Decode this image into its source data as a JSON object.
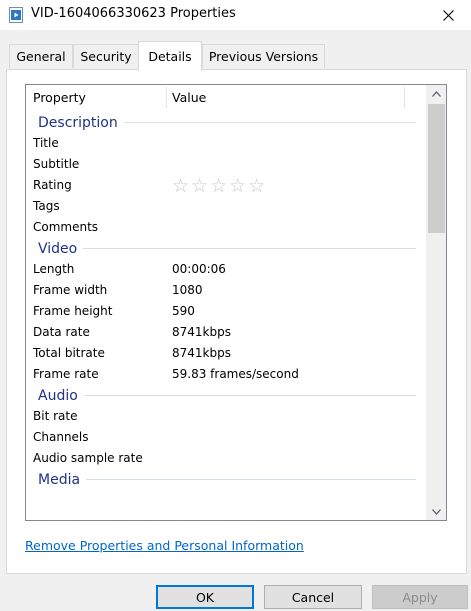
{
  "window": {
    "title": "VID-1604066330623 Properties",
    "icon": "video-file-icon",
    "close_icon": "close-icon"
  },
  "tabs": [
    {
      "label": "General",
      "active": false
    },
    {
      "label": "Security",
      "active": false
    },
    {
      "label": "Details",
      "active": true
    },
    {
      "label": "Previous Versions",
      "active": false
    }
  ],
  "details": {
    "columns": {
      "property": "Property",
      "value": "Value"
    },
    "groups": [
      {
        "name": "Description",
        "rows": [
          {
            "property": "Title",
            "value": ""
          },
          {
            "property": "Subtitle",
            "value": ""
          },
          {
            "property": "Rating",
            "value": "",
            "stars": 5
          },
          {
            "property": "Tags",
            "value": ""
          },
          {
            "property": "Comments",
            "value": ""
          }
        ]
      },
      {
        "name": "Video",
        "rows": [
          {
            "property": "Length",
            "value": "00:00:06"
          },
          {
            "property": "Frame width",
            "value": "1080"
          },
          {
            "property": "Frame height",
            "value": "590"
          },
          {
            "property": "Data rate",
            "value": "8741kbps"
          },
          {
            "property": "Total bitrate",
            "value": "8741kbps"
          },
          {
            "property": "Frame rate",
            "value": "59.83 frames/second"
          }
        ]
      },
      {
        "name": "Audio",
        "rows": [
          {
            "property": "Bit rate",
            "value": ""
          },
          {
            "property": "Channels",
            "value": ""
          },
          {
            "property": "Audio sample rate",
            "value": ""
          }
        ]
      },
      {
        "name": "Media",
        "rows": []
      }
    ]
  },
  "link_text": "Remove Properties and Personal Information",
  "buttons": {
    "ok": "OK",
    "cancel": "Cancel",
    "apply": "Apply"
  },
  "colors": {
    "group_heading": "#1e3287",
    "link": "#0066cc",
    "default_button_border": "#0078d7"
  }
}
